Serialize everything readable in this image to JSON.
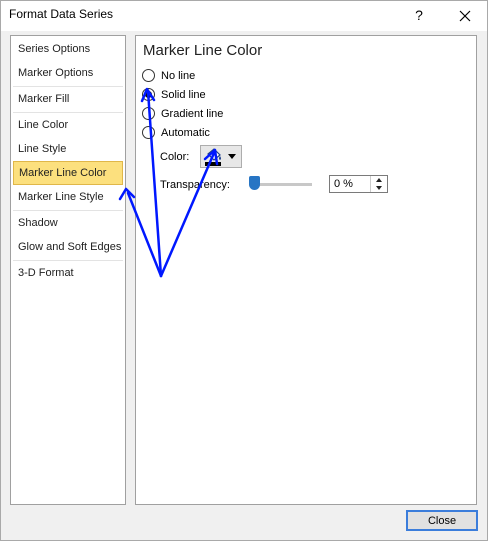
{
  "window": {
    "title": "Format Data Series",
    "help_label": "?"
  },
  "sidebar": {
    "items": [
      {
        "label": "Series Options"
      },
      {
        "label": "Marker Options"
      },
      {
        "label": "Marker Fill"
      },
      {
        "label": "Line Color"
      },
      {
        "label": "Line Style"
      },
      {
        "label": "Marker Line Color",
        "selected": true
      },
      {
        "label": "Marker Line Style"
      },
      {
        "label": "Shadow"
      },
      {
        "label": "Glow and Soft Edges"
      },
      {
        "label": "3-D Format"
      }
    ]
  },
  "main": {
    "section_title": "Marker Line Color",
    "options": [
      {
        "label": "No line",
        "checked": false
      },
      {
        "label": "Solid line",
        "checked": true
      },
      {
        "label": "Gradient line",
        "checked": false
      },
      {
        "label": "Automatic",
        "checked": false
      }
    ],
    "color_label": "Color:",
    "color_value": "#000000",
    "transparency_label": "Transparency:",
    "transparency_value": "0 %",
    "transparency_percent": 0
  },
  "footer": {
    "close_label": "Close"
  },
  "annotation": {
    "color": "#0018ff"
  }
}
